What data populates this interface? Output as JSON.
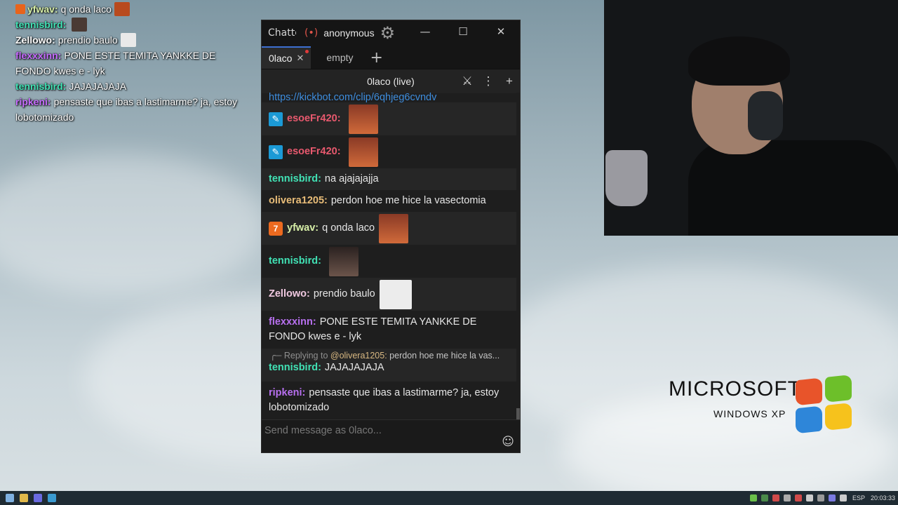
{
  "overlay": [
    {
      "user": "yfwav:",
      "text": "q onda laco",
      "color": "#d8f0a8",
      "badge": true,
      "emote_color": "#b84a1e"
    },
    {
      "user": "tennisbird:",
      "text": "",
      "color": "#41e2b5",
      "emote_color": "#4a3a34"
    },
    {
      "user": "Zellowo:",
      "text": "prendio baulo",
      "color": "#ffffff",
      "emote_color": "#e9e9e9"
    },
    {
      "user": "flexxxinn:",
      "text": "PONE ESTE TEMITA YANKKE DE FONDO kwes e - lyk",
      "color": "#c76cff"
    },
    {
      "user": "tennisbird:",
      "text": "JAJAJAJAJA",
      "color": "#41e2b5"
    },
    {
      "user": "ripkeni:",
      "text": "pensaste que ibas a lastimarme? ja, estoy lobotomizado",
      "color": "#c76cff"
    }
  ],
  "window": {
    "app_title": "Chatterino",
    "live_icon": "(•)",
    "account": "anonymous",
    "minimize": "—",
    "maximize": "☐",
    "close": "✕"
  },
  "tabs": [
    {
      "label": "0laco",
      "active": true
    },
    {
      "label": "empty",
      "active": false
    }
  ],
  "add_tab": "+",
  "split": {
    "title": "0laco (live)",
    "menu": "⋮",
    "add": "+"
  },
  "messages": [
    {
      "type": "link",
      "text": "https://kickbot.com/clip/6qhjeg6cvndv"
    },
    {
      "user": "esoeFr420:",
      "color": "#e8596e",
      "badge": "kick",
      "text": "",
      "emote_color": "#b8532e"
    },
    {
      "user": "esoeFr420:",
      "color": "#e8596e",
      "badge": "kick",
      "text": "",
      "emote_color": "#b8532e"
    },
    {
      "user": "tennisbird:",
      "color": "#41e2b5",
      "text": "na ajajajajja"
    },
    {
      "user": "olivera1205:",
      "color": "#e8bc78",
      "text": "perdon hoe me hice la vasectomia"
    },
    {
      "user": "yfwav:",
      "color": "#d8f0a8",
      "badge": "orange",
      "text": "q onda laco",
      "emote_color": "#b8532e"
    },
    {
      "user": "tennisbird:",
      "color": "#41e2b5",
      "text": "",
      "emote_color": "#3d302b"
    },
    {
      "user": "Zellowo:",
      "color": "#f0c8e0",
      "text": "prendio baulo",
      "emote_color": "#e8e8e8"
    },
    {
      "user": "flexxxinn:",
      "color": "#b870f0",
      "text": "PONE ESTE TEMITA YANKKE DE FONDO kwes e - lyk"
    },
    {
      "reply_to": "@olivera1205:",
      "reply_text": "perdon hoe me hice la vas...",
      "reply_prefix": "Replying to",
      "user": "tennisbird:",
      "color": "#41e2b5",
      "text": "JAJAJAJAJA"
    },
    {
      "user": "ripkeni:",
      "color": "#b870f0",
      "text": "pensaste que ibas a lastimarme? ja, estoy lobotomizado"
    }
  ],
  "input": {
    "placeholder": "Send message as 0laco...",
    "emoji": "☺"
  },
  "desktop": {
    "brand": "MICROSOFT",
    "product": "WINDOWS XP"
  },
  "taskbar": {
    "lang": "ESP",
    "time": "20:03:33"
  }
}
